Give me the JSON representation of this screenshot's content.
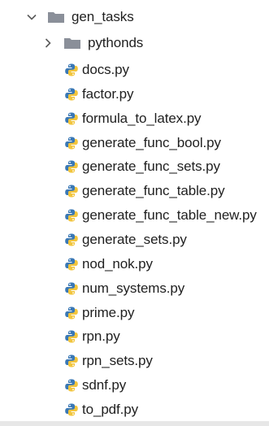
{
  "tree": {
    "root": {
      "label": "gen_tasks",
      "expanded": true,
      "icon": "folder-icon"
    },
    "subfolder": {
      "label": "pythonds",
      "expanded": false,
      "icon": "folder-icon"
    },
    "files": [
      {
        "label": "docs.py",
        "icon": "python-file-icon"
      },
      {
        "label": "factor.py",
        "icon": "python-file-icon"
      },
      {
        "label": "formula_to_latex.py",
        "icon": "python-file-icon"
      },
      {
        "label": "generate_func_bool.py",
        "icon": "python-file-icon"
      },
      {
        "label": "generate_func_sets.py",
        "icon": "python-file-icon"
      },
      {
        "label": "generate_func_table.py",
        "icon": "python-file-icon"
      },
      {
        "label": "generate_func_table_new.py",
        "icon": "python-file-icon"
      },
      {
        "label": "generate_sets.py",
        "icon": "python-file-icon"
      },
      {
        "label": "nod_nok.py",
        "icon": "python-file-icon"
      },
      {
        "label": "num_systems.py",
        "icon": "python-file-icon"
      },
      {
        "label": "prime.py",
        "icon": "python-file-icon"
      },
      {
        "label": "rpn.py",
        "icon": "python-file-icon"
      },
      {
        "label": "rpn_sets.py",
        "icon": "python-file-icon"
      },
      {
        "label": "sdnf.py",
        "icon": "python-file-icon"
      },
      {
        "label": "to_pdf.py",
        "icon": "python-file-icon"
      }
    ]
  },
  "colors": {
    "folder": "#8a8f99",
    "python_blue": "#3a78b5",
    "python_yellow": "#f2c53d",
    "text": "#1f1f1f"
  }
}
